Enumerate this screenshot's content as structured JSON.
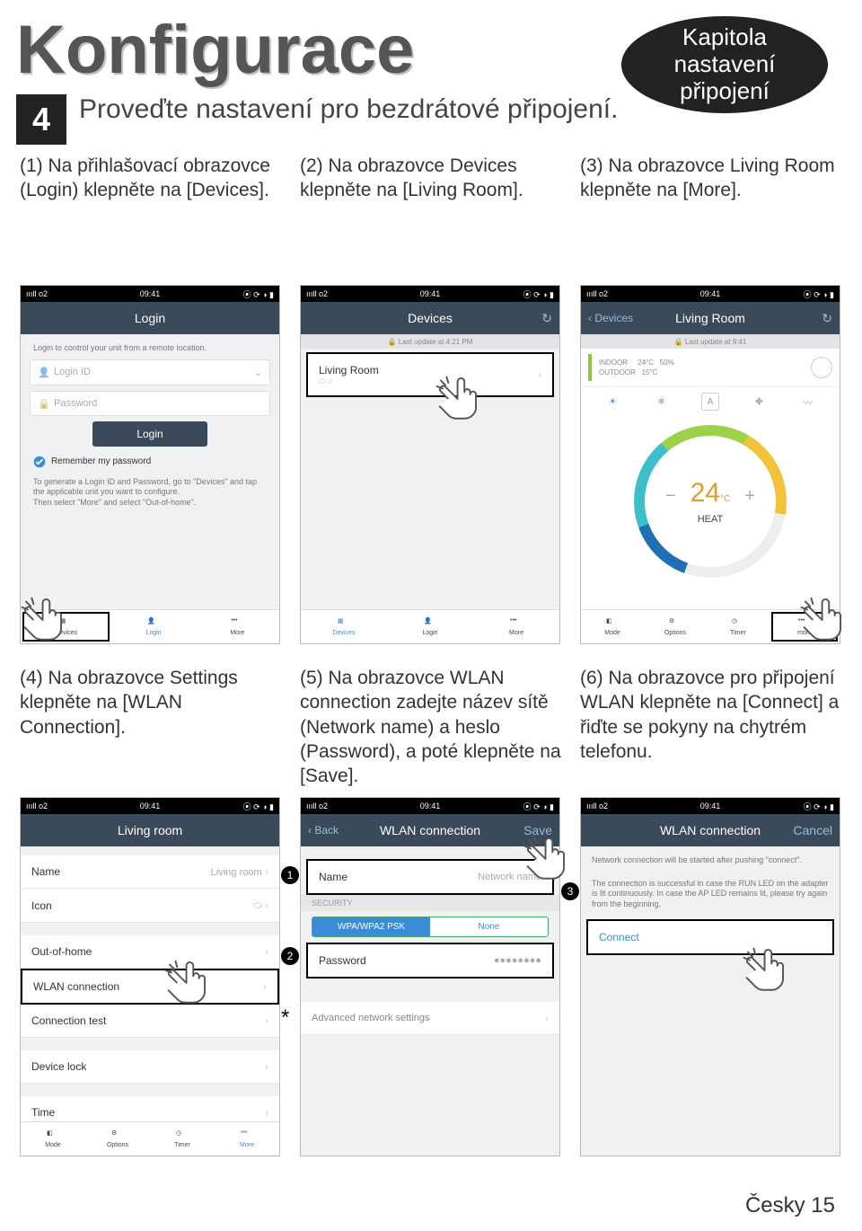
{
  "page_title": "Konfigurace",
  "chapter": {
    "l1": "Kapitola",
    "l2": "nastavení",
    "l3": "připojení"
  },
  "step": {
    "num": "4",
    "text": "Proveďte nastavení pro bezdrátové připojení."
  },
  "captions": {
    "c1": "(1) Na přihlašovací obrazovce (Login) klepněte na [Devices].",
    "c2": "(2) Na obrazovce Devices klepněte na [Living Room].",
    "c3": "(3) Na obrazovce Living Room klepněte na [More].",
    "c4": "(4) Na obrazovce Settings klepněte na [WLAN Connection].",
    "c5": "(5) Na obrazovce WLAN connection zadejte název sítě (Network name) a heslo (Password), a poté klepněte na [Save].",
    "c6": "(6) Na obrazovce pro připojení WLAN klepněte na [Connect] a řiďte se pokyny na chytrém telefonu."
  },
  "status": {
    "carrier": "ıııll o2",
    "wifi": "⋮",
    "time": "09:41",
    "right": "⦿ ⟳ ◑ ▮"
  },
  "p1": {
    "title": "Login",
    "desc": "Login to control your unit from a remote location.",
    "id_ph": "Login ID",
    "pw_ph": "Password",
    "login": "Login",
    "remember": "Remember my password",
    "note": "To generate a Login ID and Password, go to \"Devices\" and tap the applicable unit you want to configure.\nThen select \"More\" and select \"Out-of-home\".",
    "tabs": [
      "Devices",
      "Login",
      "More"
    ]
  },
  "p2": {
    "title": "Devices",
    "refresh": "↻",
    "sub": "🔒 Last update at 4:21 PM",
    "row": "Living Room",
    "tabs": [
      "Devices",
      "Login",
      "More"
    ]
  },
  "p3": {
    "title": "Living Room",
    "back": "‹ Devices",
    "refresh": "↻",
    "sub": "🔒 Last update at 9:41",
    "indoor": "INDOOR",
    "outdoor": "OUTDOOR",
    "it": "24°C",
    "ot": "15°C",
    "hum": "50%",
    "modes": [
      "☀",
      "❄",
      "A",
      "✤",
      "〰"
    ],
    "temp": "24",
    "unit": "°C",
    "heat": "HEAT",
    "tabs": [
      "Mode",
      "Options",
      "Timer",
      "more"
    ]
  },
  "p4": {
    "title": "Living room",
    "rows": {
      "name_l": "Name",
      "name_v": "Living room",
      "icon_l": "Icon",
      "ooh": "Out-of-home",
      "wlan": "WLAN connection",
      "ct": "Connection test",
      "dl": "Device lock",
      "time": "Time"
    },
    "tabs": [
      "Mode",
      "Options",
      "Timer",
      "More"
    ]
  },
  "p5": {
    "back": "‹ Back",
    "title": "WLAN connection",
    "save": "Save",
    "name_l": "Name",
    "name_ph": "Network name",
    "sec": "SECURITY",
    "seg_on": "WPA/WPA2 PSK",
    "seg_off": "None",
    "pw_l": "Password",
    "pw_v": "●●●●●●●●",
    "adv": "Advanced network settings"
  },
  "p6": {
    "title": "WLAN connection",
    "cancel": "Cancel",
    "l1": "Network connection will be started after pushing \"connect\".",
    "l2": "The connection is successful in case the RUN LED on the adapter is lit continuously. In case the AP LED remains lit, please try again from the beginning.",
    "connect": "Connect"
  },
  "footer": "Česky 15"
}
